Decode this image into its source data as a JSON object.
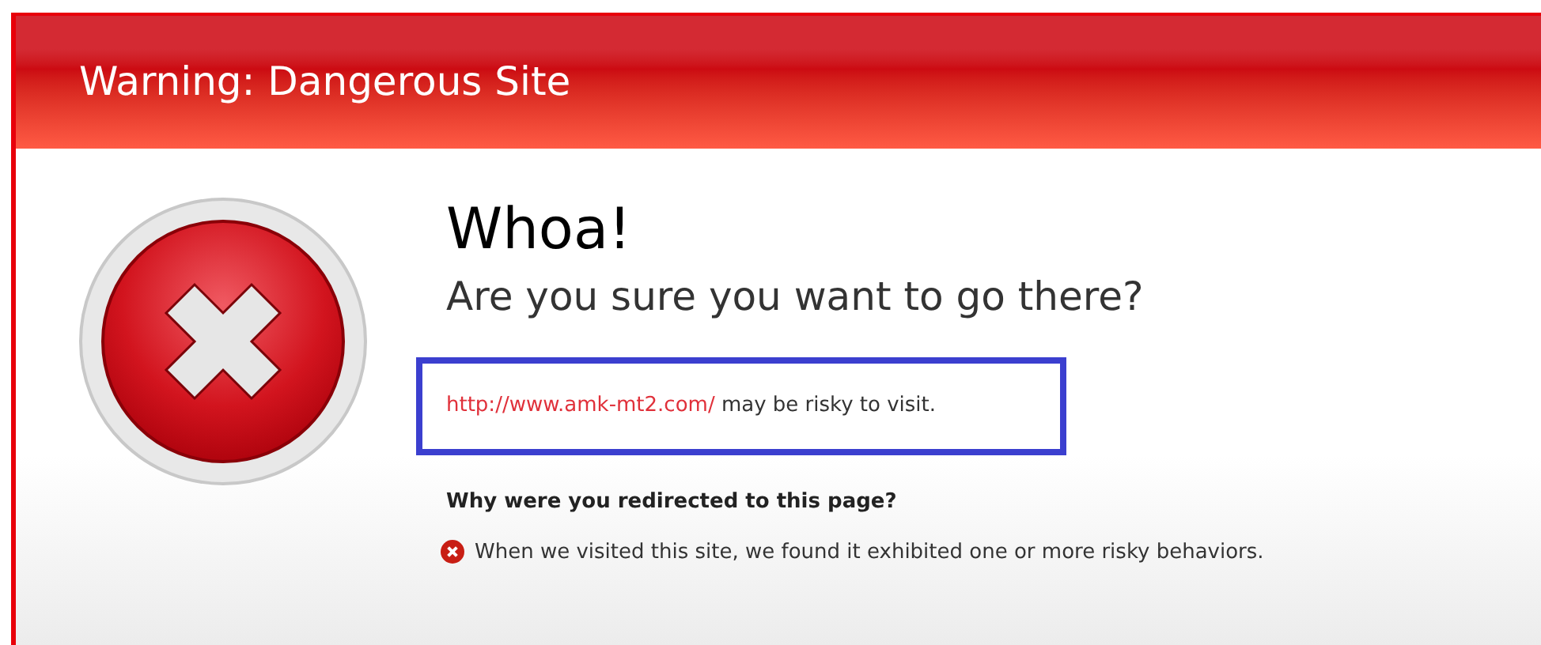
{
  "header": {
    "title": "Warning: Dangerous Site"
  },
  "heading": "Whoa!",
  "subheading": "Are you sure you want to go there?",
  "notice": {
    "url": "http://www.amk-mt2.com/",
    "text": "may be risky to visit."
  },
  "reasons": {
    "title": "Why were you redirected to this page?",
    "items": [
      "When we visited this site, we found it exhibited one or more risky behaviors."
    ]
  }
}
